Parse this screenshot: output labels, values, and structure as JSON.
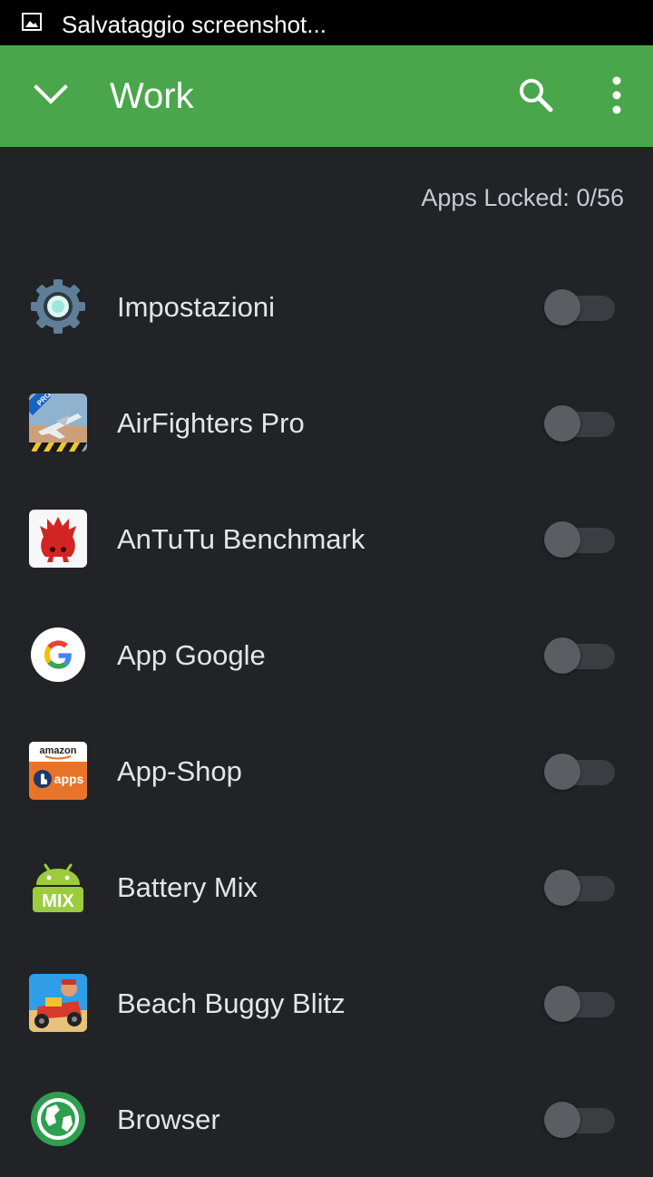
{
  "status_bar": {
    "notification_icon": "image-icon",
    "text": "Salvataggio screenshot..."
  },
  "toolbar": {
    "title": "Work",
    "collapse_icon": "chevron-down-icon",
    "search_icon": "search-icon",
    "more_icon": "more-vert-icon",
    "color": "#4aa64b"
  },
  "summary": {
    "locked_text": "Apps Locked: 0/56"
  },
  "apps": [
    {
      "name": "Impostazioni",
      "icon": "settings-gear-icon",
      "locked": false
    },
    {
      "name": "AirFighters Pro",
      "icon": "airfighters-pro-icon",
      "locked": false
    },
    {
      "name": "AnTuTu Benchmark",
      "icon": "antutu-icon",
      "locked": false
    },
    {
      "name": "App Google",
      "icon": "google-icon",
      "locked": false
    },
    {
      "name": "App-Shop",
      "icon": "amazon-apps-icon",
      "locked": false
    },
    {
      "name": "Battery Mix",
      "icon": "android-battery-mix-icon",
      "locked": false
    },
    {
      "name": "Beach Buggy Blitz",
      "icon": "beach-buggy-blitz-icon",
      "locked": false
    },
    {
      "name": "Browser",
      "icon": "browser-globe-icon",
      "locked": false
    }
  ],
  "icon_labels": {
    "airfighters_badge": "PRO",
    "amazon_wordmark": "amazon",
    "amazon_apps": "apps",
    "battery_mix": "MIX"
  }
}
